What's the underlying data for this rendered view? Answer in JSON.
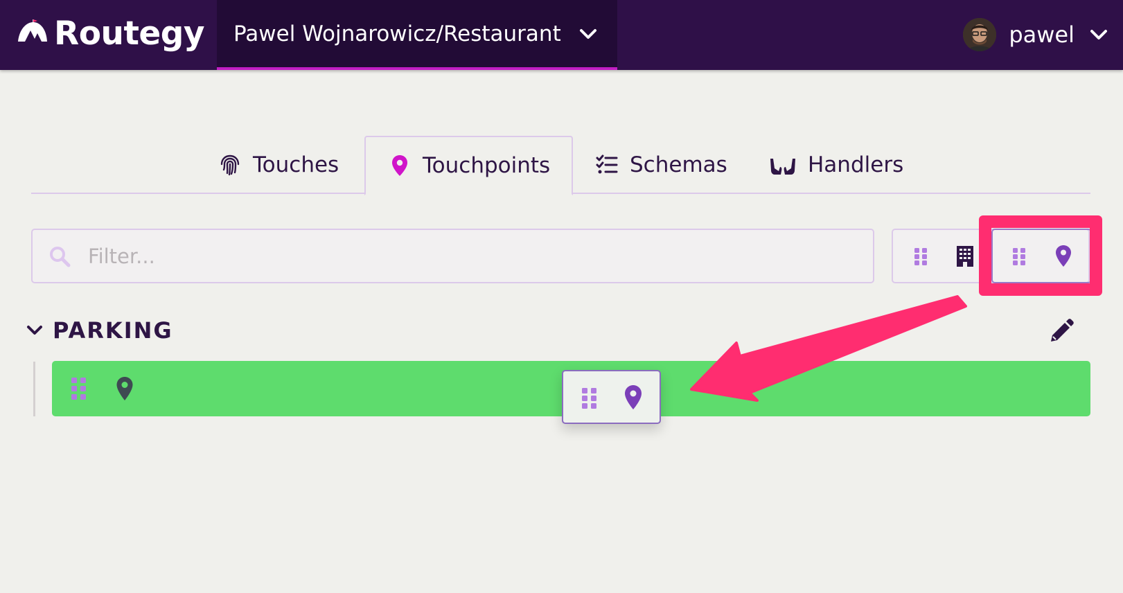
{
  "header": {
    "brand": "Routegy",
    "project": "Pawel Wojnarowicz/Restaurant",
    "user": "pawel"
  },
  "tabs": [
    {
      "label": "Touches",
      "icon": "fingerprint-icon"
    },
    {
      "label": "Touchpoints",
      "icon": "map-pin-icon",
      "active": true
    },
    {
      "label": "Schemas",
      "icon": "checklist-icon"
    },
    {
      "label": "Handlers",
      "icon": "hands-icon"
    }
  ],
  "filter": {
    "placeholder": "Filter..."
  },
  "view_toggles": [
    {
      "icon": "drag-handle-icon"
    },
    {
      "icon": "building-icon"
    },
    {
      "icon": "drag-handle-icon"
    },
    {
      "icon": "map-pin-icon",
      "selected": true
    }
  ],
  "group": {
    "title": "PARKING"
  },
  "colors": {
    "header_bg": "#2f1048",
    "accent": "#c21ec4",
    "row_bg": "#5edc6d",
    "annotation": "#ff2d70",
    "icon_purple": "#7b3fb8",
    "icon_light_purple": "#b07be0"
  }
}
